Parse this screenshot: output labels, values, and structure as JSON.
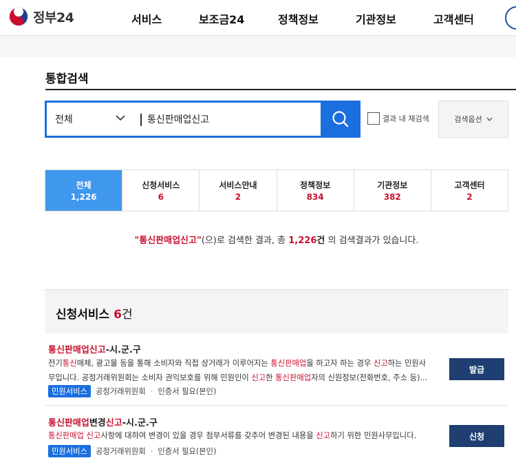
{
  "header": {
    "logo_text": "정부24",
    "nav": [
      "서비스",
      "보조금24",
      "정책정보",
      "기관정보",
      "고객센터"
    ]
  },
  "page": {
    "title": "통합검색"
  },
  "search": {
    "scope_selected": "전체",
    "query": "통신판매업신고",
    "in_result_label": "결과 내 재검색",
    "options_label": "검색옵션"
  },
  "tabs": [
    {
      "label": "전체",
      "count": "1,226"
    },
    {
      "label": "신청서비스",
      "count": "6"
    },
    {
      "label": "서비스안내",
      "count": "2"
    },
    {
      "label": "정책정보",
      "count": "834"
    },
    {
      "label": "기관정보",
      "count": "382"
    },
    {
      "label": "고객센터",
      "count": "2"
    }
  ],
  "summary": {
    "keyword": "\"통신판매업신고\"",
    "part1": "(으)로 검색한 결과, 총 ",
    "total": "1,226",
    "unit": "건",
    "part2": " 의 검색결과가 있습니다."
  },
  "section": {
    "title": "신청서비스",
    "count": "6",
    "unit": "건"
  },
  "results": [
    {
      "title": [
        {
          "t": "통신판매업신고",
          "hl": true
        },
        {
          "t": "-시.군.구",
          "hl": false
        }
      ],
      "desc": [
        [
          {
            "t": "전기",
            "hl": false
          },
          {
            "t": "통신",
            "hl": true
          },
          {
            "t": "매체, 광고물 등을 통해 소비자와 직접 상거래가 이루어지는 ",
            "hl": false
          },
          {
            "t": "통신판매업",
            "hl": true
          },
          {
            "t": "을 하고자 하는 경우 ",
            "hl": false
          },
          {
            "t": "신고",
            "hl": true
          },
          {
            "t": "하는 민원사",
            "hl": false
          }
        ],
        [
          {
            "t": "무입니다. 공정거래위원회는 소비자 권익보호를 위해 민원인이 ",
            "hl": false
          },
          {
            "t": "신고",
            "hl": true
          },
          {
            "t": "한 ",
            "hl": false
          },
          {
            "t": "통신판매업",
            "hl": true
          },
          {
            "t": "자의 신원정보(전화번호, 주소 등)...",
            "hl": false
          }
        ]
      ],
      "badge": "민원서비스",
      "org": "공정거래위원회",
      "cert": "인증서 필요(본인)",
      "action": "발급"
    },
    {
      "title": [
        {
          "t": "통신판매업",
          "hl": true
        },
        {
          "t": "변경",
          "hl": false
        },
        {
          "t": "신고",
          "hl": true
        },
        {
          "t": "-시.군.구",
          "hl": false
        }
      ],
      "desc": [
        [
          {
            "t": "통신판매업 신고",
            "hl": true
          },
          {
            "t": "사항에 대하여 변경이 있을 경우 첨부서류를 갖추어 변경된 내용을 ",
            "hl": false
          },
          {
            "t": "신고",
            "hl": true
          },
          {
            "t": "하기 위한 민원사무입니다.",
            "hl": false
          }
        ]
      ],
      "badge": "민원서비스",
      "org": "공정거래위원회",
      "cert": "인증서 필요(본인)",
      "action": "신청"
    }
  ]
}
